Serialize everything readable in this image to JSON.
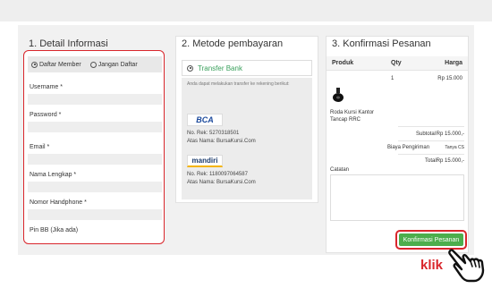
{
  "columns": {
    "detail": {
      "title": "1. Detail Informasi",
      "radio_options": [
        "Daftar Member",
        "Jangan Daftar"
      ],
      "fields": [
        "Username *",
        "Password *",
        "Email *",
        "Nama Lengkap *",
        "Nomor Handphone *",
        "Pin BB (Jika ada)"
      ]
    },
    "payment": {
      "title": "2. Metode pembayaran",
      "option_label": "Transfer Bank",
      "note": "Anda dapat melakukan transfer ke rekening berikut:",
      "banks": [
        {
          "logo": "BCA",
          "account": "No. Rek: 5270318501",
          "holder": "Atas Nama: BursaKursi.Com"
        },
        {
          "logo": "mandiri",
          "account": "No. Rek: 1180097064587",
          "holder": "Atas Nama: BursaKursi.Com"
        }
      ]
    },
    "confirm": {
      "title": "3. Konfirmasi Pesanan",
      "headers": {
        "product": "Produk",
        "qty": "Qty",
        "price": "Harga"
      },
      "item": {
        "name_line1": "Roda Kursi Kantor",
        "name_line2": "Tancap RRC",
        "qty": "1",
        "price": "Rp 15.000"
      },
      "subtotal_label": "Subtotal",
      "subtotal_value": "Rp 15.000,-",
      "shipping_label": "Biaya Pengiriman",
      "shipping_value": "Tanya CS",
      "total_label": "Total",
      "total_value": "Rp 15.000,-",
      "notes_label": "Catatan"
    }
  },
  "confirm_button": "Konfirmasi Pesanan",
  "annotation": "klik",
  "colors": {
    "highlight": "#d9262c",
    "button": "#4cae4c",
    "accent": "#3aa05c"
  },
  "icons": {
    "pointer": "hand-pointer-icon",
    "product": "caster-wheel-icon"
  }
}
